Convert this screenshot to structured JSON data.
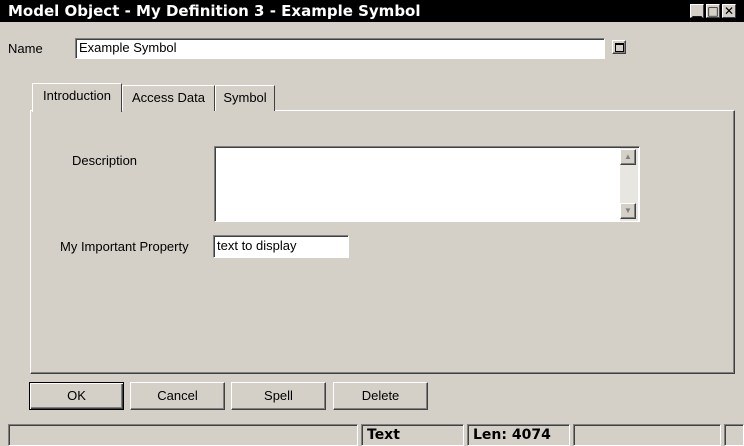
{
  "window": {
    "title": "Model Object - My Definition 3 - Example Symbol",
    "controls": {
      "minimize": "_",
      "maximize": "□",
      "close": "✕"
    }
  },
  "name_field": {
    "label": "Name",
    "value": "Example Symbol"
  },
  "tabs": [
    {
      "label": "Introduction",
      "active": true
    },
    {
      "label": "Access Data",
      "active": false
    },
    {
      "label": "Symbol",
      "active": false
    }
  ],
  "form": {
    "description_label": "Description",
    "description_value": "",
    "property_label": "My Important Property",
    "property_value": "text to display"
  },
  "buttons": {
    "ok": "OK",
    "cancel": "Cancel",
    "spell": "Spell",
    "delete": "Delete"
  },
  "statusbar": {
    "mode": "Text",
    "length": "Len: 4074"
  },
  "colors": {
    "titlebar": "#000000",
    "face": "#d4d0c8"
  }
}
